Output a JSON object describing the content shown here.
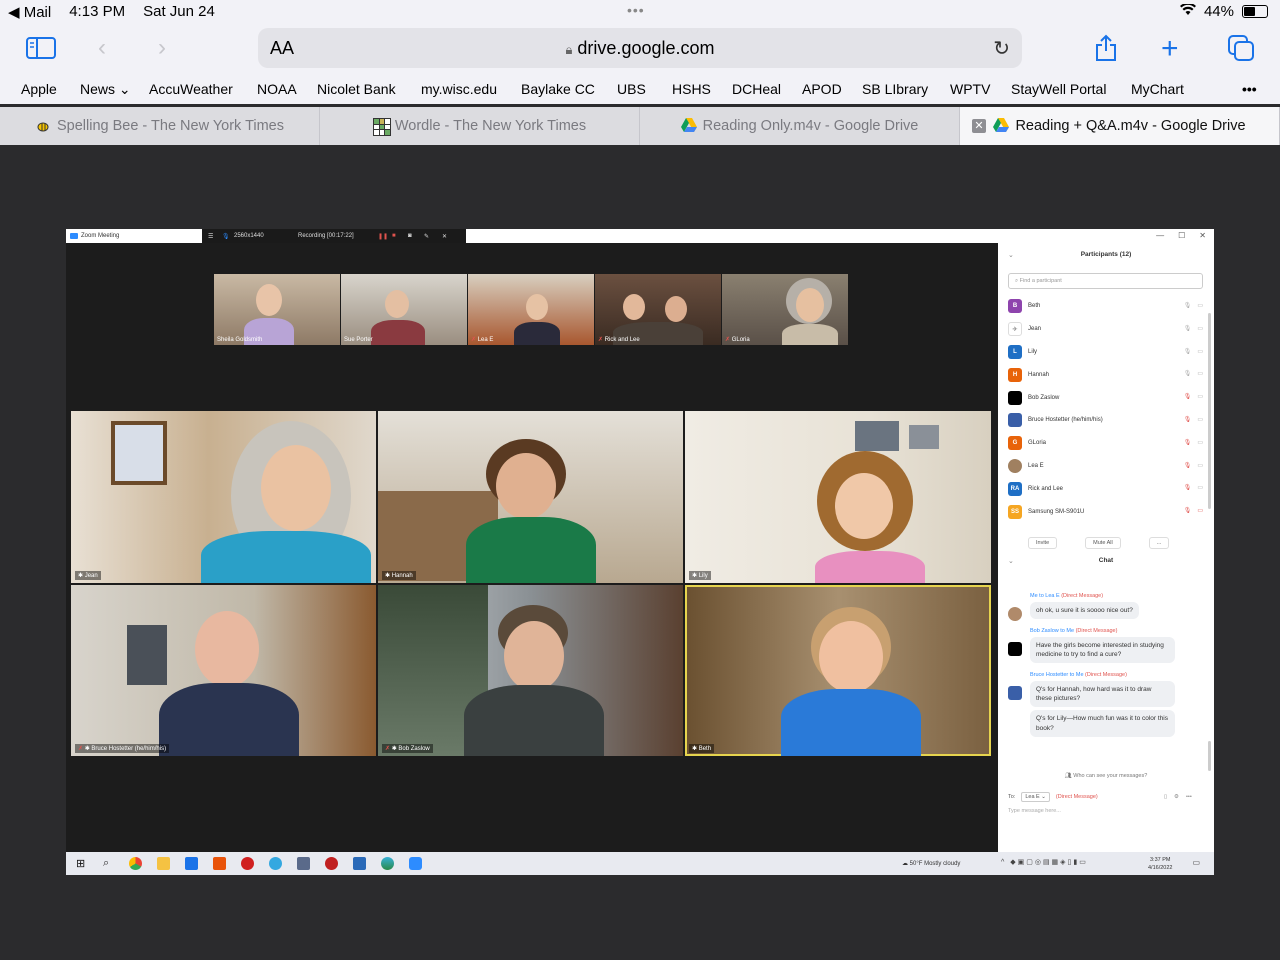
{
  "status_bar": {
    "back_app": "Mail",
    "time": "4:13 PM",
    "date": "Sat Jun 24",
    "battery": "44%",
    "battery_level": 0.44
  },
  "toolbar": {
    "text_size": "AA",
    "url": "drive.google.com"
  },
  "bookmarks": [
    "Apple",
    "News",
    "AccuWeather",
    "NOAA",
    "Nicolet Bank",
    "my.wisc.edu",
    "Baylake CC",
    "UBS",
    "HSHS",
    "DCHeal",
    "APOD",
    "SB LIbrary",
    "WPTV",
    "StayWell Portal",
    "MyChart"
  ],
  "tabs": [
    {
      "label": "Spelling Bee - The New York Times",
      "icon": "bee-icon"
    },
    {
      "label": "Wordle - The New York Times",
      "icon": "wordle-grid-icon"
    },
    {
      "label": "Reading Only.m4v - Google Drive",
      "icon": "google-drive-icon"
    },
    {
      "label": "Reading + Q&A.m4v - Google Drive",
      "icon": "google-drive-icon",
      "active": true
    }
  ],
  "zoom": {
    "window_title": "Zoom Meeting",
    "resolution": "2560x1440",
    "recording": "Recording [00:17:22]",
    "thumbnails": [
      "Sheila Goldsmith",
      "Sue Porter",
      "Lea E",
      "Rick and Lee",
      "GLoria"
    ],
    "gallery": [
      "Jean",
      "Hannah",
      "Lily",
      "Bruce Hostetter (he/him/his)",
      "Bob Zaslow",
      "Beth"
    ],
    "participants_title": "Participants (12)",
    "search_placeholder": "Find a participant",
    "participants": [
      {
        "name": "Beth",
        "initial": "B",
        "color": "#8e44ad",
        "muted": false
      },
      {
        "name": "Jean",
        "initial": "",
        "color": "#ffffff",
        "muted": false
      },
      {
        "name": "Lily",
        "initial": "L",
        "color": "#1f6fc5",
        "muted": false
      },
      {
        "name": "Hannah",
        "initial": "H",
        "color": "#e8630a",
        "muted": false
      },
      {
        "name": "Bob Zaslow",
        "initial": "",
        "color": "#000000",
        "muted": true
      },
      {
        "name": "Bruce Hostetter (he/him/his)",
        "initial": "",
        "color": "#3a5fa8",
        "muted": true
      },
      {
        "name": "GLoria",
        "initial": "G",
        "color": "#e8630a",
        "muted": true
      },
      {
        "name": "Lea E",
        "initial": "",
        "color": "#a08060",
        "muted": true
      },
      {
        "name": "Rick and Lee",
        "initial": "RA",
        "color": "#1f6fc5",
        "muted": true
      },
      {
        "name": "Samsung SM-S901U",
        "initial": "SS",
        "color": "#f5a623",
        "muted": true
      }
    ],
    "invite": "Invite",
    "mute_all": "Mute All",
    "more": "...",
    "chat_title": "Chat",
    "chat": [
      {
        "from": "Me",
        "to": "Lea E",
        "dm": "(Direct Message)",
        "messages": [
          "oh ok, u sure it is soooo nice out?"
        ],
        "avatar_color": "#b08a6a"
      },
      {
        "from": "Bob Zaslow",
        "to": "Me",
        "dm": "(Direct Message)",
        "messages": [
          "Have the girls become interested in studying medicine to try to find a cure?"
        ],
        "avatar_color": "#000000"
      },
      {
        "from": "Bruce Hostetter",
        "to": "Me",
        "dm": "(Direct Message)",
        "messages": [
          "Q's for Hannah, how hard was it to draw these pictures?",
          "Q's for Lily—How much fun was it to color this book?"
        ],
        "avatar_color": "#3a5fa8"
      }
    ],
    "who_can_see": "Who can see your messages?",
    "to_label": "To:",
    "to_value": "Lea E",
    "to_dm": "(Direct Message)",
    "type_placeholder": "Type message here...",
    "weather": "50°F Mostly cloudy",
    "clock_time": "3:37 PM",
    "clock_date": "4/16/2022"
  }
}
